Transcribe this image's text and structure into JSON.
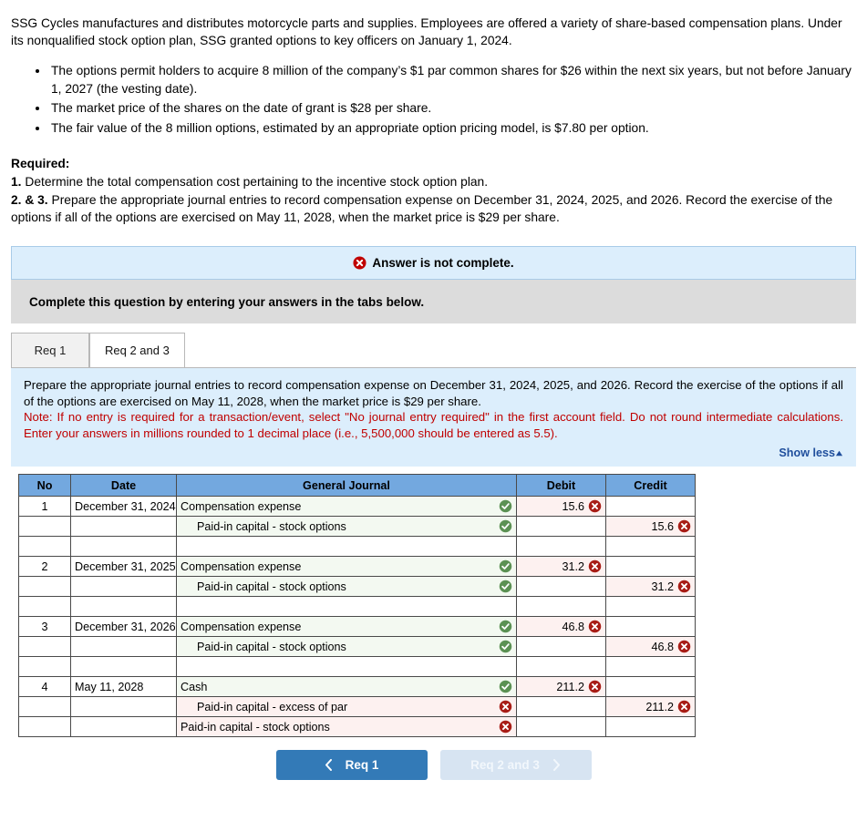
{
  "problem": {
    "intro_p1": "SSG Cycles manufactures and distributes motorcycle parts and supplies. Employees are offered a variety of share-based compensation plans. Under its nonqualified stock option plan, SSG granted options to key officers on January 1, 2024.",
    "bullets": [
      "The options permit holders to acquire 8 million of the company’s $1 par common shares for $26 within the next six years, but not before January 1, 2027 (the vesting date).",
      "The market price of the shares on the date of grant is $28 per share.",
      "The fair value of the 8 million options, estimated by an appropriate option pricing model, is $7.80 per option."
    ]
  },
  "required": {
    "heading": "Required:",
    "item1_num": "1.",
    "item1_text": " Determine the total compensation cost pertaining to the incentive stock option plan.",
    "item2_num": "2. & 3.",
    "item2_text": " Prepare the appropriate journal entries to record compensation expense on December 31, 2024, 2025, and 2026. Record the exercise of the options if all of the options are exercised on May 11, 2028, when the market price is $29 per share."
  },
  "alerts": {
    "incomplete_text": "Answer is not complete.",
    "incomplete_icon": "error-circle-icon",
    "complete_instruction": "Complete this question by entering your answers in the tabs below."
  },
  "tabs": [
    {
      "label": "Req 1",
      "active": false
    },
    {
      "label": "Req 2 and 3",
      "active": true
    }
  ],
  "instruction_panel": {
    "body": "Prepare the appropriate journal entries to record compensation expense on December 31, 2024, 2025, and 2026. Record the exercise of the options if all of the options are exercised on May 11, 2028, when the market price is $29 per share.",
    "note": "Note: If no entry is required for a transaction/event, select \"No journal entry required\" in the first account field. Do not round intermediate calculations. Enter your answers in millions rounded to 1 decimal place (i.e., 5,500,000 should be entered as 5.5).",
    "show_less_label": "Show less",
    "show_less_icon": "chevron-up-icon"
  },
  "journal": {
    "columns": [
      "No",
      "Date",
      "General Journal",
      "Debit",
      "Credit"
    ],
    "rows": [
      {
        "no": "1",
        "date": "December 31, 2024",
        "account": "Compensation expense",
        "indent": false,
        "status": "valid",
        "debit": "15.6",
        "debit_status": "invalid",
        "credit": "",
        "credit_status": "",
        "row_bg": "green"
      },
      {
        "no": "",
        "date": "",
        "account": "Paid-in capital - stock options",
        "indent": true,
        "status": "valid",
        "debit": "",
        "debit_status": "",
        "credit": "15.6",
        "credit_status": "invalid",
        "row_bg": "green"
      },
      {
        "no": "",
        "date": "",
        "account": "",
        "indent": false,
        "status": "",
        "debit": "",
        "debit_status": "",
        "credit": "",
        "credit_status": "",
        "row_bg": "white"
      },
      {
        "no": "2",
        "date": "December 31, 2025",
        "account": "Compensation expense",
        "indent": false,
        "status": "valid",
        "debit": "31.2",
        "debit_status": "invalid",
        "credit": "",
        "credit_status": "",
        "row_bg": "green"
      },
      {
        "no": "",
        "date": "",
        "account": "Paid-in capital - stock options",
        "indent": true,
        "status": "valid",
        "debit": "",
        "debit_status": "",
        "credit": "31.2",
        "credit_status": "invalid",
        "row_bg": "green"
      },
      {
        "no": "",
        "date": "",
        "account": "",
        "indent": false,
        "status": "",
        "debit": "",
        "debit_status": "",
        "credit": "",
        "credit_status": "",
        "row_bg": "white"
      },
      {
        "no": "3",
        "date": "December 31, 2026",
        "account": "Compensation expense",
        "indent": false,
        "status": "valid",
        "debit": "46.8",
        "debit_status": "invalid",
        "credit": "",
        "credit_status": "",
        "row_bg": "green"
      },
      {
        "no": "",
        "date": "",
        "account": "Paid-in capital - stock options",
        "indent": true,
        "status": "valid",
        "debit": "",
        "debit_status": "",
        "credit": "46.8",
        "credit_status": "invalid",
        "row_bg": "green"
      },
      {
        "no": "",
        "date": "",
        "account": "",
        "indent": false,
        "status": "",
        "debit": "",
        "debit_status": "",
        "credit": "",
        "credit_status": "",
        "row_bg": "white"
      },
      {
        "no": "4",
        "date": "May 11, 2028",
        "account": "Cash",
        "indent": false,
        "status": "valid",
        "debit": "211.2",
        "debit_status": "invalid",
        "credit": "",
        "credit_status": "",
        "row_bg": "green"
      },
      {
        "no": "",
        "date": "",
        "account": "Paid-in capital - excess of par",
        "indent": true,
        "status": "invalid",
        "debit": "",
        "debit_status": "",
        "credit": "211.2",
        "credit_status": "invalid",
        "row_bg": "pink"
      },
      {
        "no": "",
        "date": "",
        "account": "Paid-in capital - stock options",
        "indent": false,
        "status": "invalid",
        "debit": "",
        "debit_status": "",
        "credit": "",
        "credit_status": "",
        "row_bg": "pink"
      }
    ]
  },
  "nav": {
    "prev_label": "Req 1",
    "prev_icon": "chevron-left-icon",
    "next_label": "Req 2 and 3",
    "next_icon": "chevron-right-icon"
  },
  "colors": {
    "header_blue": "#73a8df",
    "panel_blue": "#dceefc",
    "grey_bar": "#dcdcdc",
    "note_red": "#c00000",
    "valid_green": "#4f8a4a",
    "invalid_red": "#a81d16",
    "primary_button": "#337ab7",
    "muted_button": "#d7e4f2",
    "link_blue": "#1f4e9c"
  }
}
